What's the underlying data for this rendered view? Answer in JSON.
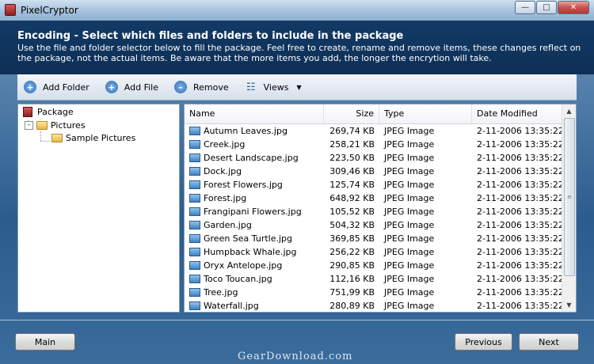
{
  "window": {
    "title": "PixelCryptor",
    "min_icon": "minimize-icon",
    "max_icon": "maximize-icon",
    "close_icon": "close-icon"
  },
  "header": {
    "title": "Encoding - Select which files and folders to include in the package",
    "description": "Use the file and folder selector below to fill the package. Feel free to create, rename and remove items, these changes reflect on the package, not the actual items. Be aware that the more items you add, the longer the encrytion will take."
  },
  "toolbar": {
    "add_folder": "Add Folder",
    "add_file": "Add File",
    "remove": "Remove",
    "views": "Views"
  },
  "tree": {
    "root": "Package",
    "folder": "Pictures",
    "subfolder": "Sample Pictures"
  },
  "list": {
    "columns": [
      "Name",
      "Size",
      "Type",
      "Date Modified"
    ],
    "rows": [
      {
        "name": "Autumn Leaves.jpg",
        "size": "269,74 KB",
        "type": "JPEG Image",
        "date": "2-11-2006 13:35:22"
      },
      {
        "name": "Creek.jpg",
        "size": "258,21 KB",
        "type": "JPEG Image",
        "date": "2-11-2006 13:35:22"
      },
      {
        "name": "Desert Landscape.jpg",
        "size": "223,50 KB",
        "type": "JPEG Image",
        "date": "2-11-2006 13:35:22"
      },
      {
        "name": "Dock.jpg",
        "size": "309,46 KB",
        "type": "JPEG Image",
        "date": "2-11-2006 13:35:22"
      },
      {
        "name": "Forest Flowers.jpg",
        "size": "125,74 KB",
        "type": "JPEG Image",
        "date": "2-11-2006 13:35:22"
      },
      {
        "name": "Forest.jpg",
        "size": "648,92 KB",
        "type": "JPEG Image",
        "date": "2-11-2006 13:35:22"
      },
      {
        "name": "Frangipani Flowers.jpg",
        "size": "105,52 KB",
        "type": "JPEG Image",
        "date": "2-11-2006 13:35:22"
      },
      {
        "name": "Garden.jpg",
        "size": "504,32 KB",
        "type": "JPEG Image",
        "date": "2-11-2006 13:35:22"
      },
      {
        "name": "Green Sea Turtle.jpg",
        "size": "369,85 KB",
        "type": "JPEG Image",
        "date": "2-11-2006 13:35:22"
      },
      {
        "name": "Humpback Whale.jpg",
        "size": "256,22 KB",
        "type": "JPEG Image",
        "date": "2-11-2006 13:35:22"
      },
      {
        "name": "Oryx Antelope.jpg",
        "size": "290,85 KB",
        "type": "JPEG Image",
        "date": "2-11-2006 13:35:22"
      },
      {
        "name": "Toco Toucan.jpg",
        "size": "112,16 KB",
        "type": "JPEG Image",
        "date": "2-11-2006 13:35:22"
      },
      {
        "name": "Tree.jpg",
        "size": "751,99 KB",
        "type": "JPEG Image",
        "date": "2-11-2006 13:35:22"
      },
      {
        "name": "Waterfall.jpg",
        "size": "280,89 KB",
        "type": "JPEG Image",
        "date": "2-11-2006 13:35:22"
      }
    ]
  },
  "footer": {
    "main": "Main",
    "previous": "Previous",
    "next": "Next"
  },
  "watermark": "GearDownload.com"
}
